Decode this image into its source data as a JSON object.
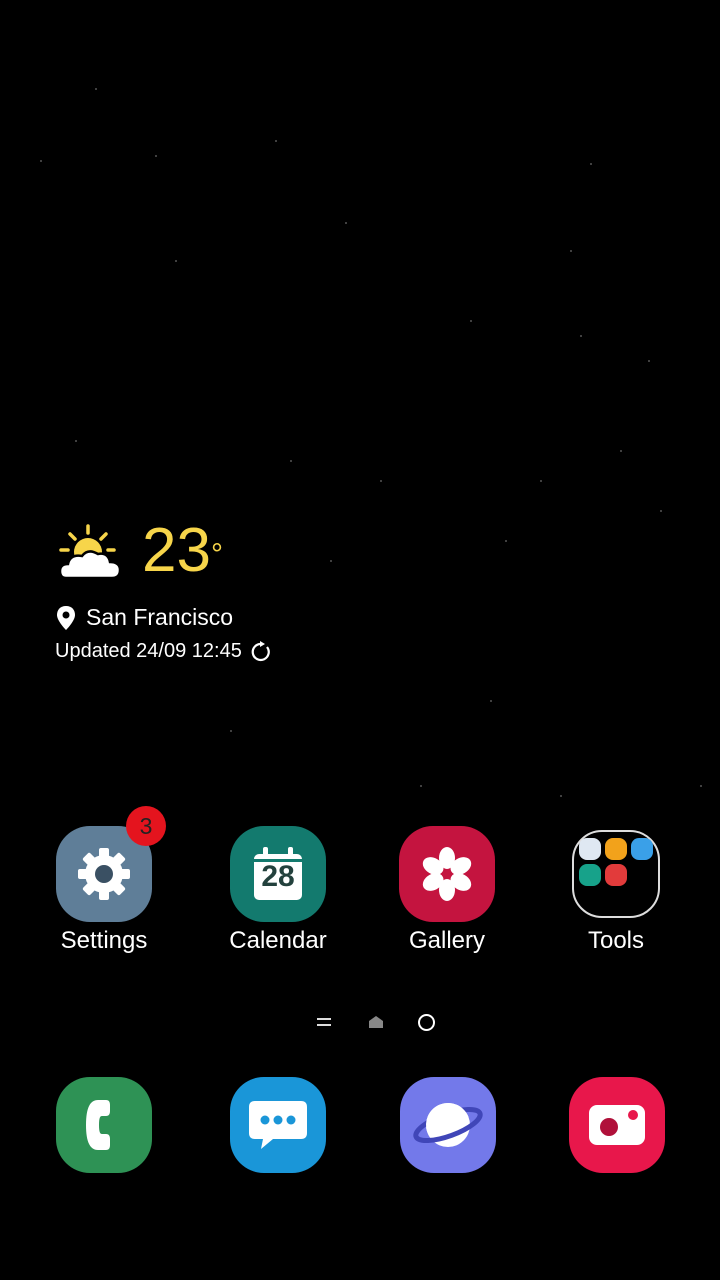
{
  "weather": {
    "temperature": "23",
    "unit": "°",
    "location": "San Francisco",
    "updated": "Updated 24/09 12:45",
    "icon": "partly-sunny-icon"
  },
  "apps": [
    {
      "label": "Settings",
      "icon": "gear-icon",
      "color": "#5f7e98",
      "badge": "3"
    },
    {
      "label": "Calendar",
      "icon": "calendar-icon",
      "color": "#137a6e",
      "day": "28"
    },
    {
      "label": "Gallery",
      "icon": "flower-icon",
      "color": "#c4143f"
    },
    {
      "label": "Tools",
      "icon": "folder-icon",
      "color": "#000000"
    }
  ],
  "page_indicator": {
    "icons": [
      "menu-lines-icon",
      "home-icon",
      "page-dot-icon"
    ],
    "current_page": 3
  },
  "dock": [
    {
      "name": "Phone",
      "icon": "phone-icon",
      "color": "#2e9255"
    },
    {
      "name": "Messages",
      "icon": "message-icon",
      "color": "#1a96d8"
    },
    {
      "name": "Internet",
      "icon": "planet-icon",
      "color": "#7379ea"
    },
    {
      "name": "Camera",
      "icon": "camera-icon",
      "color": "#e8174b"
    }
  ]
}
